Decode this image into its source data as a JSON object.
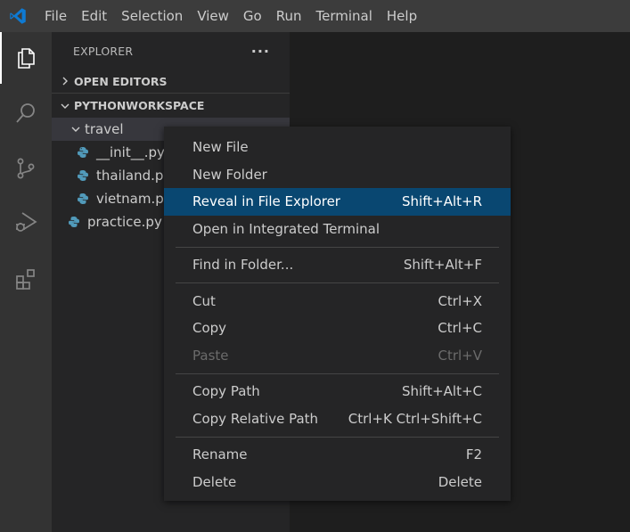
{
  "menubar": {
    "items": [
      "File",
      "Edit",
      "Selection",
      "View",
      "Go",
      "Run",
      "Terminal",
      "Help"
    ]
  },
  "activitybar": {
    "icons": [
      "files-icon",
      "search-icon",
      "source-control-icon",
      "run-debug-icon",
      "extensions-icon"
    ]
  },
  "explorer": {
    "title": "EXPLORER",
    "more": "···",
    "open_editors": "OPEN EDITORS",
    "workspace": "PYTHONWORKSPACE",
    "folder": "travel",
    "files": [
      "__init__.py",
      "thailand.py",
      "vietnam.py"
    ],
    "root_file": "practice.py"
  },
  "context_menu": {
    "items": [
      {
        "label": "New File",
        "shortcut": ""
      },
      {
        "label": "New Folder",
        "shortcut": ""
      },
      {
        "label": "Reveal in File Explorer",
        "shortcut": "Shift+Alt+R"
      },
      {
        "label": "Open in Integrated Terminal",
        "shortcut": ""
      },
      {
        "label": "Find in Folder...",
        "shortcut": "Shift+Alt+F"
      },
      {
        "label": "Cut",
        "shortcut": "Ctrl+X"
      },
      {
        "label": "Copy",
        "shortcut": "Ctrl+C"
      },
      {
        "label": "Paste",
        "shortcut": "Ctrl+V"
      },
      {
        "label": "Copy Path",
        "shortcut": "Shift+Alt+C"
      },
      {
        "label": "Copy Relative Path",
        "shortcut": "Ctrl+K Ctrl+Shift+C"
      },
      {
        "label": "Rename",
        "shortcut": "F2"
      },
      {
        "label": "Delete",
        "shortcut": "Delete"
      }
    ]
  },
  "colors": {
    "accent_vscode": "#0e7ad3",
    "menu_highlight": "#094771",
    "python_icon": "#519aba"
  }
}
